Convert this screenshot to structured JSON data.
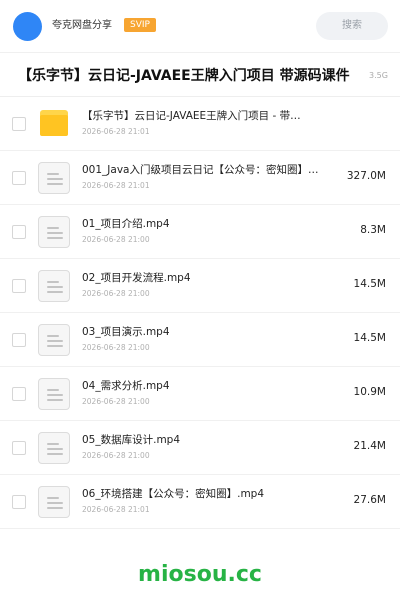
{
  "header": {
    "owner_name": "夸克网盘分享",
    "badge": "SVIP",
    "search_label": "搜索"
  },
  "share": {
    "title": "【乐字节】云日记-JAVAEE王牌入门项目 带源码课件",
    "total_size": "3.5G"
  },
  "files": [
    {
      "type": "folder",
      "name": "【乐字节】云日记-JAVAEE王牌入门项目 - 带…",
      "date": "2026-06-28 21:01",
      "size": ""
    },
    {
      "type": "file",
      "name": "001_Java入门级项目云日记【公众号：密知圈】…",
      "date": "2026-06-28 21:01",
      "size": "327.0M"
    },
    {
      "type": "file",
      "name": "01_项目介绍.mp4",
      "date": "2026-06-28 21:00",
      "size": "8.3M"
    },
    {
      "type": "file",
      "name": "02_项目开发流程.mp4",
      "date": "2026-06-28 21:00",
      "size": "14.5M"
    },
    {
      "type": "file",
      "name": "03_项目演示.mp4",
      "date": "2026-06-28 21:00",
      "size": "14.5M"
    },
    {
      "type": "file",
      "name": "04_需求分析.mp4",
      "date": "2026-06-28 21:00",
      "size": "10.9M"
    },
    {
      "type": "file",
      "name": "05_数据库设计.mp4",
      "date": "2026-06-28 21:00",
      "size": "21.4M"
    },
    {
      "type": "file",
      "name": "06_环境搭建【公众号：密知圈】.mp4",
      "date": "2026-06-28 21:01",
      "size": "27.6M"
    }
  ],
  "watermark": "miosou.cc",
  "colors": {
    "avatar": "#2f86f6",
    "badge": "#f7a531",
    "folder": "#ffc422",
    "watermark": "#27b345"
  }
}
